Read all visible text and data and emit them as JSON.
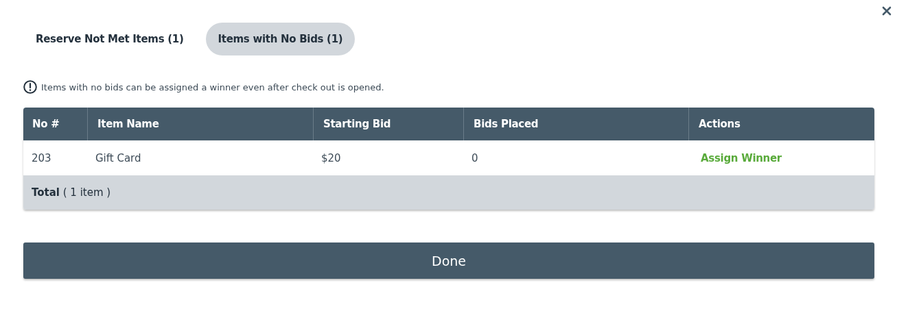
{
  "tabs": [
    {
      "label": "Reserve Not Met Items (1)",
      "selected": false
    },
    {
      "label": "Items with No Bids (1)",
      "selected": true
    }
  ],
  "notice": "Items with no bids can be assigned a winner even after check out is opened.",
  "table": {
    "columns": [
      "No #",
      "Item Name",
      "Starting Bid",
      "Bids Placed",
      "Actions"
    ],
    "rows": [
      {
        "number": "203",
        "item_name": "Gift Card",
        "starting_bid": "$20",
        "bids_placed": "0",
        "action": "Assign Winner"
      }
    ],
    "total": "**Total** ( 1 item )"
  },
  "done_button": "Done"
}
